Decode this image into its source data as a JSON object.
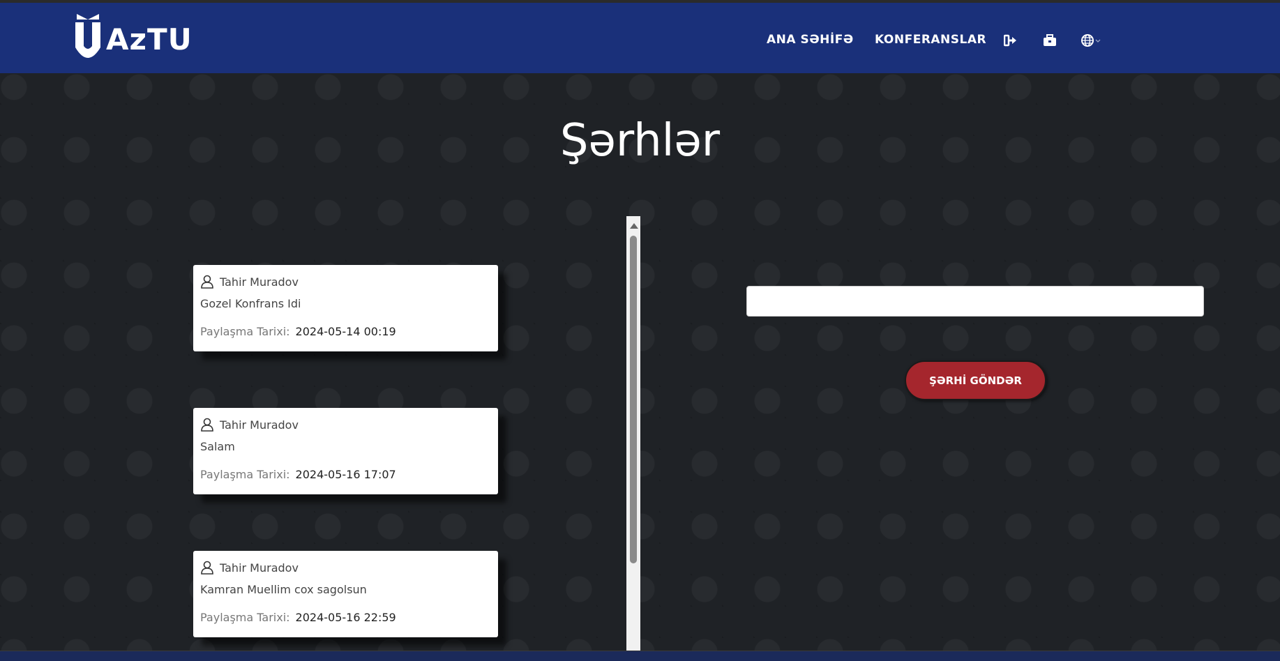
{
  "header": {
    "logo_text": "AzTU",
    "nav": [
      {
        "label": "ANA SƏHİFƏ"
      },
      {
        "label": "KONFERANSLAR"
      }
    ],
    "icons": [
      "sign-out-icon",
      "toolbox-icon",
      "globe-icon"
    ]
  },
  "main": {
    "title": "Şərhlər",
    "comments": [
      {
        "author": "Tahir Muradov",
        "text": "Gozel Konfrans Idi",
        "date_label": "Paylaşma Tarixi:",
        "date": "2024-05-14 00:19"
      },
      {
        "author": "Tahir Muradov",
        "text": "Salam",
        "date_label": "Paylaşma Tarixi:",
        "date": "2024-05-16 17:07"
      },
      {
        "author": "Tahir Muradov",
        "text": "Kamran Muellim cox sagolsun",
        "date_label": "Paylaşma Tarixi:",
        "date": "2024-05-16 22:59"
      }
    ],
    "comment_input": {
      "value": "",
      "placeholder": ""
    },
    "submit_label": "ŞƏRHİ GÖNDƏR"
  },
  "colors": {
    "navbar": "#1a307a",
    "background": "#1f2226",
    "button": "#a5262d"
  }
}
